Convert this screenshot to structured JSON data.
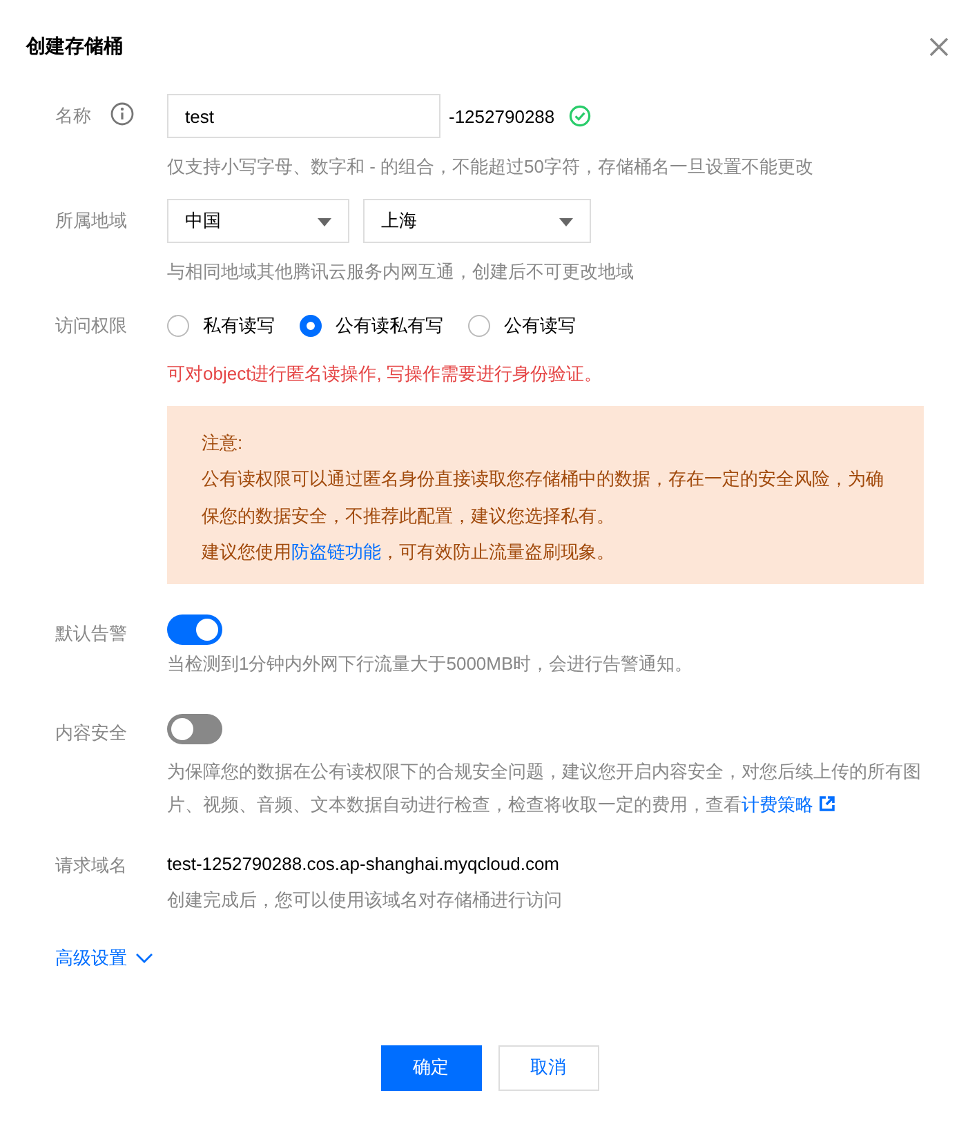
{
  "dialog": {
    "title": "创建存储桶"
  },
  "name_row": {
    "label": "名称",
    "value": "test",
    "suffix": "-1252790288",
    "valid": true,
    "hint": "仅支持小写字母、数字和 - 的组合，不能超过50字符，存储桶名一旦设置不能更改"
  },
  "region_row": {
    "label": "所属地域",
    "selects": [
      {
        "value": "中国"
      },
      {
        "value": "上海"
      }
    ],
    "hint": "与相同地域其他腾讯云服务内网互通，创建后不可更改地域"
  },
  "access_row": {
    "label": "访问权限",
    "options": [
      {
        "label": "私有读写",
        "selected": false
      },
      {
        "label": "公有读私有写",
        "selected": true
      },
      {
        "label": "公有读写",
        "selected": false
      }
    ],
    "warning": "可对object进行匿名读操作, 写操作需要进行身份验证。",
    "notice": {
      "title": "注意:",
      "lines": [
        "公有读权限可以通过匿名身份直接读取您存储桶中的数据，存在一定的安全风险，为确保您的数据安全，不推荐此配置，建议您选择私有。"
      ],
      "link_before": "建议您使用",
      "link": "防盗链功能",
      "link_after": "，可有效防止流量盗刷现象。"
    }
  },
  "switch_rows": [
    {
      "label": "默认告警",
      "on": true,
      "hint": "当检测到1分钟内外网下行流量大于5000MB时，会进行告警通知。"
    },
    {
      "label": "内容安全",
      "on": false,
      "hint": "为保障您的数据在公有读权限下的合规安全问题，建议您开启内容安全，对您后续上传的所有图片、视频、音频、文本数据自动进行检查，检查将收取一定的费用，查看",
      "link": "计费策略"
    }
  ],
  "domain_row": {
    "label": "请求域名",
    "value": "test-1252790288.cos.ap-shanghai.myqcloud.com",
    "hint": "创建完成后，您可以使用该域名对存储桶进行访问"
  },
  "advanced": {
    "label": "高级设置",
    "expanded": false
  },
  "buttons": [
    {
      "label": "确定",
      "kind": "primary"
    },
    {
      "label": "取消",
      "kind": "secondary"
    }
  ]
}
